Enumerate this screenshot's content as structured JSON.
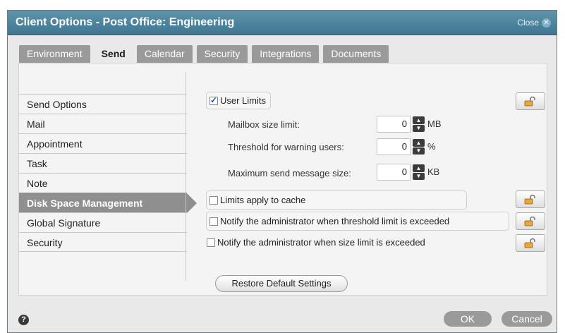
{
  "dialog": {
    "title": "Client Options - Post Office: Engineering",
    "close_label": "Close",
    "close_icon": "close-icon"
  },
  "tabs": [
    {
      "label": "Environment",
      "active": false
    },
    {
      "label": "Send",
      "active": true
    },
    {
      "label": "Calendar",
      "active": false
    },
    {
      "label": "Security",
      "active": false
    },
    {
      "label": "Integrations",
      "active": false
    },
    {
      "label": "Documents",
      "active": false
    }
  ],
  "sidebar": {
    "items": [
      {
        "label": "Send Options"
      },
      {
        "label": "Mail"
      },
      {
        "label": "Appointment"
      },
      {
        "label": "Task"
      },
      {
        "label": "Note"
      },
      {
        "label": "Disk Space Management",
        "active": true
      },
      {
        "label": "Global Signature"
      },
      {
        "label": "Security"
      }
    ]
  },
  "options": {
    "user_limits": {
      "label": "User Limits",
      "checked": true
    },
    "mailbox_size": {
      "label": "Mailbox size limit:",
      "value": "0",
      "unit": "MB"
    },
    "threshold": {
      "label": "Threshold for warning users:",
      "value": "0",
      "unit": "%"
    },
    "max_send": {
      "label": "Maximum send message size:",
      "value": "0",
      "unit": "KB"
    },
    "limits_cache": {
      "label": "Limits apply to cache",
      "checked": false
    },
    "notify_threshold": {
      "label": "Notify the administrator when threshold limit is exceeded",
      "checked": false
    },
    "notify_size": {
      "label": "Notify the administrator when size limit is exceeded",
      "checked": false
    }
  },
  "restore_label": "Restore Default Settings",
  "footer": {
    "help_glyph": "?",
    "ok_label": "OK",
    "cancel_label": "Cancel"
  },
  "colors": {
    "titlebar": "#4a84a0",
    "tab_inactive": "#9a9a9a",
    "sidebar_active": "#8f8f8f"
  }
}
